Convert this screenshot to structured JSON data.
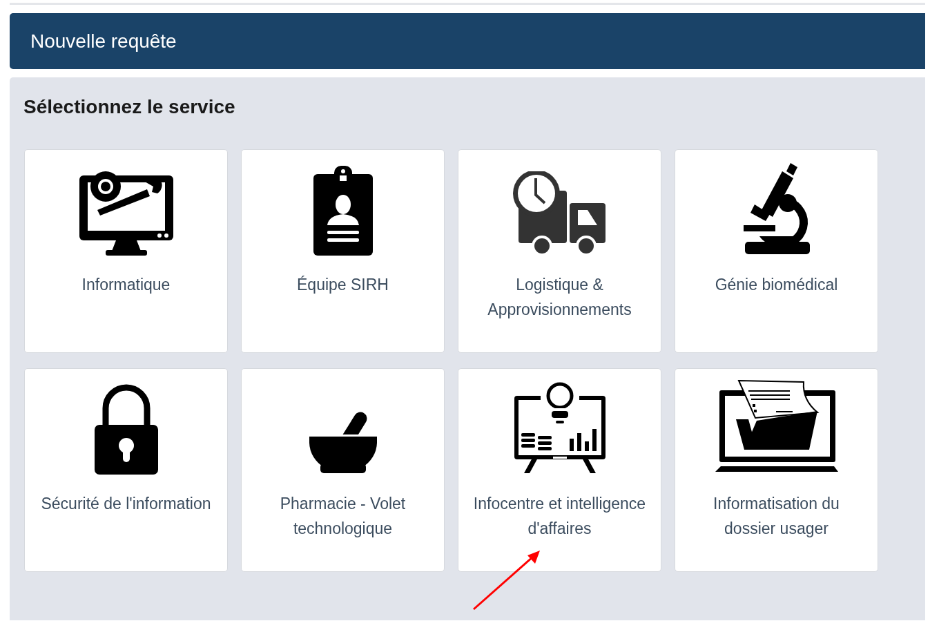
{
  "header": {
    "title": "Nouvelle requête"
  },
  "panel": {
    "title": "Sélectionnez le service"
  },
  "services": [
    {
      "label": "Informatique"
    },
    {
      "label": "Équipe SIRH"
    },
    {
      "label": "Logistique & Approvisionnements"
    },
    {
      "label": "Génie biomédical"
    },
    {
      "label": "Sécurité de l'information"
    },
    {
      "label": "Pharmacie - Volet technologique"
    },
    {
      "label": "Infocentre et intelligence d'affaires"
    },
    {
      "label": "Informatisation du dossier usager"
    }
  ]
}
